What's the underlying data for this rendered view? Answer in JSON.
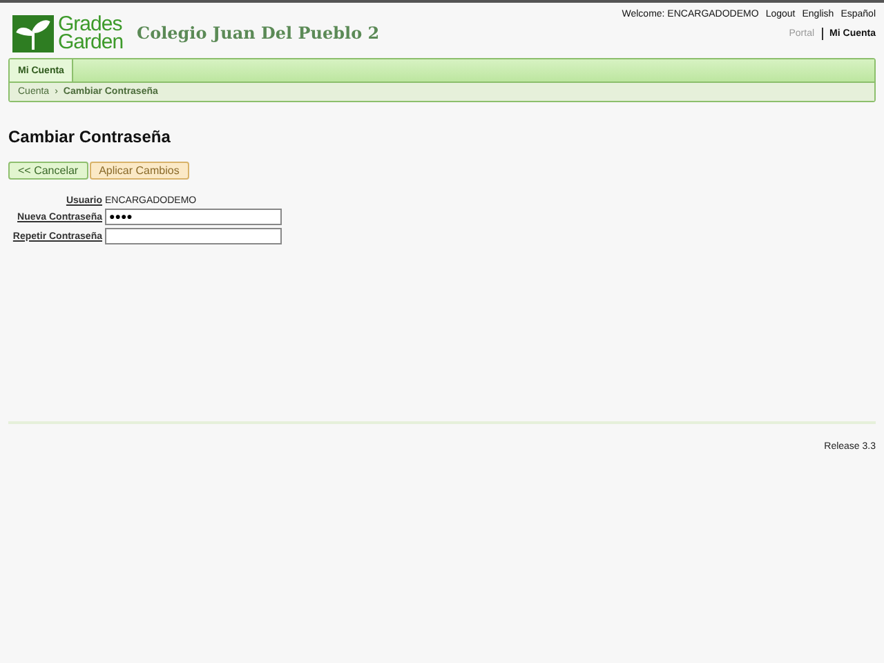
{
  "logo": {
    "line1": "Grades",
    "line2": "Garden"
  },
  "school_name": "Colegio Juan Del Pueblo 2",
  "user_bar": {
    "welcome": "Welcome: ENCARGADODEMO",
    "links": [
      "Logout",
      "English",
      "Español"
    ]
  },
  "nav_links": [
    {
      "label": "Portal",
      "selected": false
    },
    {
      "label": "Mi Cuenta",
      "selected": true
    }
  ],
  "tabs": [
    {
      "label": "Mi Cuenta",
      "selected": true
    }
  ],
  "breadcrumb": [
    {
      "label": "Cuenta"
    },
    {
      "label": "Cambiar Contraseña"
    }
  ],
  "breadcrumb_separator": "›",
  "title": "Cambiar Contraseña",
  "buttons": [
    {
      "label": "<< Cancelar",
      "kind": "cancel"
    },
    {
      "label": "Aplicar Cambios",
      "kind": "apply"
    }
  ],
  "form": [
    {
      "label": "Usuario",
      "kind": "text",
      "value": "ENCARGADODEMO"
    },
    {
      "label": "Nueva Contraseña",
      "kind": "input",
      "value": "●●●●"
    },
    {
      "label": "Repetir Contraseña",
      "kind": "input"
    }
  ],
  "footer": "Release 3.3"
}
